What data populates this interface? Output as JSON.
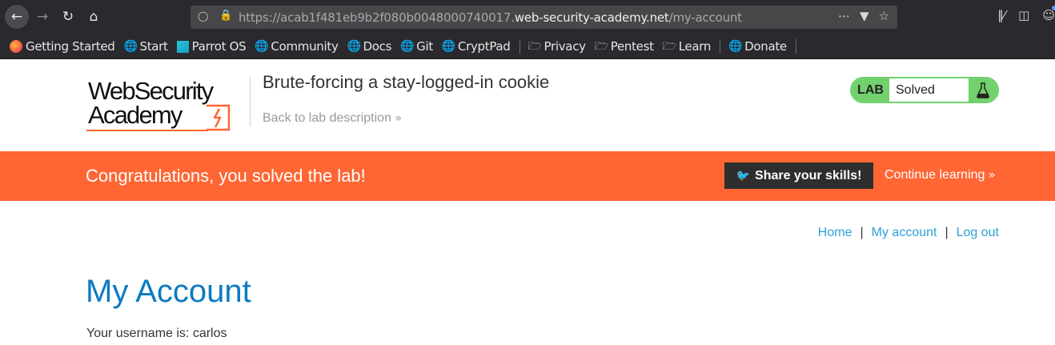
{
  "browser": {
    "url_prefix": "https://acab1f481eb9b2f080b0048000740017.",
    "url_host": "web-security-academy.net",
    "url_path": "/my-account",
    "bookmarks": [
      {
        "label": "Getting Started",
        "icon": "firefox-icon"
      },
      {
        "label": "Start",
        "icon": "globe-icon"
      },
      {
        "label": "Parrot OS",
        "icon": "parrot-icon"
      },
      {
        "label": "Community",
        "icon": "globe-icon"
      },
      {
        "label": "Docs",
        "icon": "globe-icon"
      },
      {
        "label": "Git",
        "icon": "globe-icon"
      },
      {
        "label": "CryptPad",
        "icon": "globe-icon"
      },
      {
        "label": "Privacy",
        "icon": "folder-icon"
      },
      {
        "label": "Pentest",
        "icon": "folder-icon"
      },
      {
        "label": "Learn",
        "icon": "folder-icon"
      },
      {
        "label": "Donate",
        "icon": "globe-icon"
      }
    ]
  },
  "header": {
    "logo_line1": "WebSecurity",
    "logo_line2": "Academy",
    "lab_title": "Brute-forcing a stay-logged-in cookie",
    "back_link": "Back to lab description",
    "lab_badge": "LAB",
    "lab_state": "Solved"
  },
  "banner": {
    "message": "Congratulations, you solved the lab!",
    "share_label": "Share your skills!",
    "continue_label": "Continue learning"
  },
  "nav": {
    "home": "Home",
    "my_account": "My account",
    "logout": "Log out",
    "separator": "|"
  },
  "main": {
    "heading": "My Account",
    "username_line": "Your username is: carlos"
  },
  "colors": {
    "accent_orange": "#ff6633",
    "lab_green": "#70d16d",
    "link_blue": "#2ca1d8",
    "heading_blue": "#0c7bc1"
  }
}
